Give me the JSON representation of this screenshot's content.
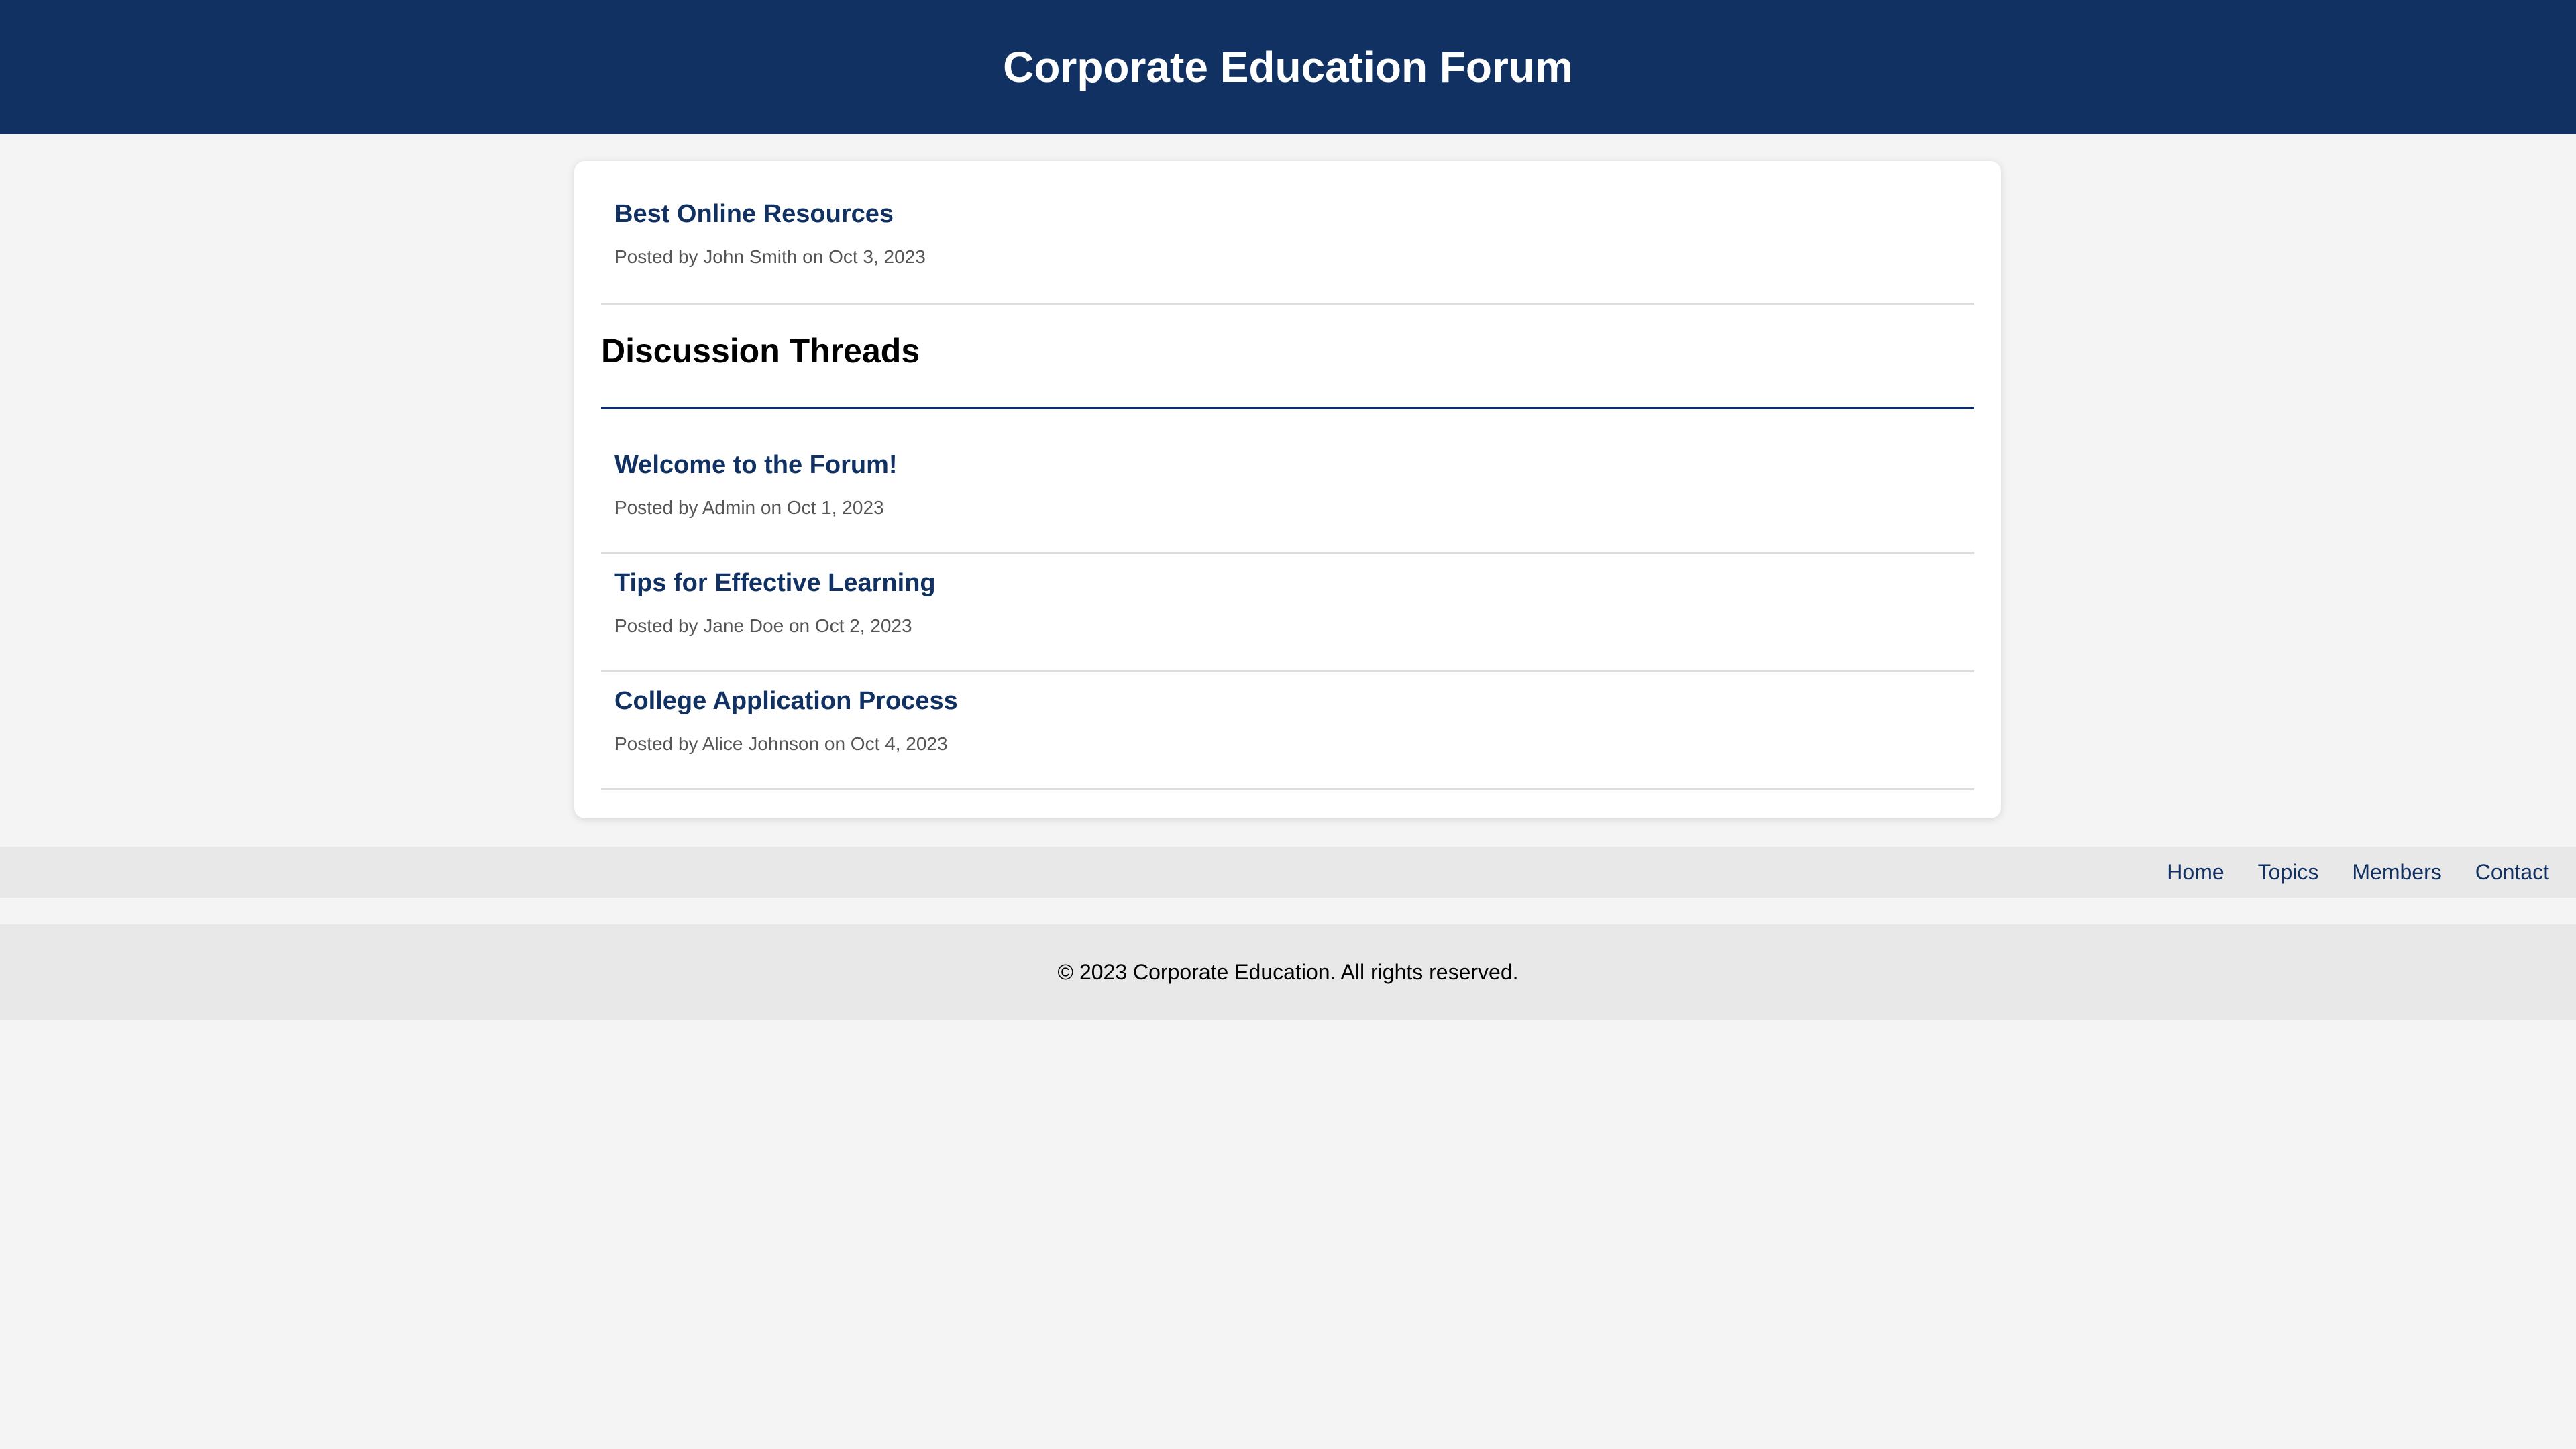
{
  "header": {
    "title": "Corporate Education Forum"
  },
  "featured_post": {
    "title": "Best Online Resources",
    "meta": "Posted by John Smith on Oct 3, 2023"
  },
  "threads_section": {
    "heading": "Discussion Threads",
    "threads": [
      {
        "title": "Welcome to the Forum!",
        "meta": "Posted by Admin on Oct 1, 2023"
      },
      {
        "title": "Tips for Effective Learning",
        "meta": "Posted by Jane Doe on Oct 2, 2023"
      },
      {
        "title": "College Application Process",
        "meta": "Posted by Alice Johnson on Oct 4, 2023"
      }
    ]
  },
  "nav": {
    "items": [
      {
        "label": "Home"
      },
      {
        "label": "Topics"
      },
      {
        "label": "Members"
      },
      {
        "label": "Contact"
      }
    ]
  },
  "footer": {
    "text": "© 2023 Corporate Education. All rights reserved."
  },
  "colors": {
    "brand": "#113163",
    "page_bg": "#f4f4f4",
    "bar_bg": "#e8e8e8"
  }
}
